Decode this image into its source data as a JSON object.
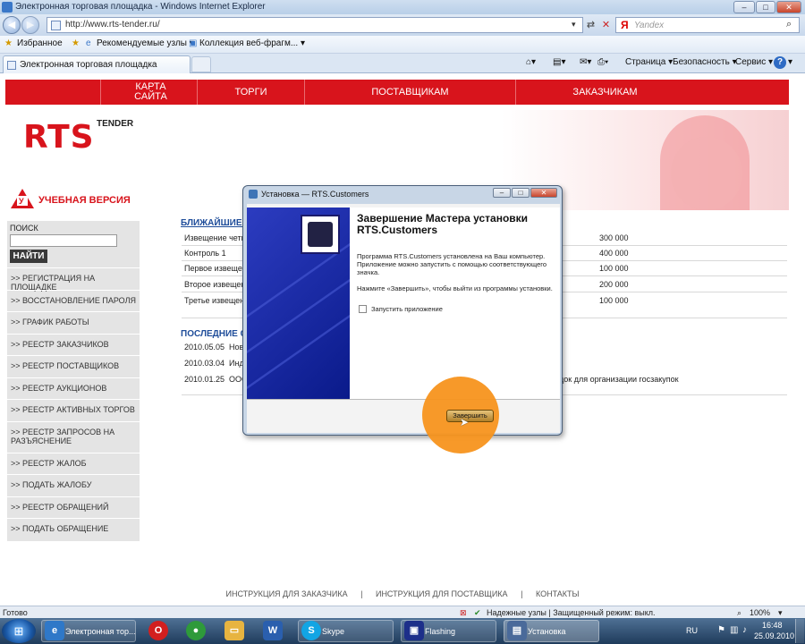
{
  "window": {
    "title": "Электронная торговая площадка - Windows Internet Explorer"
  },
  "address_bar": {
    "url": "http://www.rts-tender.ru/",
    "search_placeholder": "Yandex",
    "search_logo": "Я"
  },
  "favorites_bar": {
    "favorites_label": "Избранное",
    "items": [
      "Рекомендуемые узлы ▾",
      "Коллекция веб-фрагм... ▾"
    ]
  },
  "tabs": {
    "active_label": "Электронная торговая площадка"
  },
  "command_bar": {
    "page": "Страница ▾",
    "safety": "Безопасность ▾",
    "tools": "Сервис ▾"
  },
  "site_nav": {
    "items": [
      "КАРТА САЙТА",
      "ТОРГИ",
      "ПОСТАВЩИКАМ",
      "ЗАКАЗЧИКАМ"
    ]
  },
  "logo": {
    "main": "RTS",
    "sub": "TENDER"
  },
  "edu": {
    "label": "УЧЕБНАЯ ВЕРСИЯ",
    "sign": "У"
  },
  "sidebar": {
    "search_label": "ПОИСК",
    "search_value": "",
    "go": "НАЙТИ",
    "items": [
      ">> РЕГИСТРАЦИЯ НА ПЛОЩАДКЕ",
      ">> ВОССТАНОВЛЕНИЕ ПАРОЛЯ",
      ">> ГРАФИК РАБОТЫ",
      ">> РЕЕСТР ЗАКАЗЧИКОВ",
      ">> РЕЕСТР ПОСТАВЩИКОВ",
      ">> РЕЕСТР АУКЦИОНОВ",
      ">> РЕЕСТР АКТИВНЫХ ТОРГОВ",
      ">> РЕЕСТР ЗАПРОСОВ НА РАЗЪЯСНЕНИЕ",
      ">> РЕЕСТР ЖАЛОБ",
      ">> ПОДАТЬ ЖАЛОБУ",
      ">> РЕЕСТР ОБРАЩЕНИЙ",
      ">> ПОДАТЬ ОБРАЩЕНИЕ"
    ]
  },
  "auctions": {
    "title": "БЛИЖАЙШИЕ А",
    "rows": [
      {
        "name": "Извещение четы",
        "amount": "300 000"
      },
      {
        "name": "Контроль 1",
        "amount": "400 000"
      },
      {
        "name": "Первое извещен",
        "amount": "100 000"
      },
      {
        "name": "Второе извещен",
        "amount": "200 000"
      },
      {
        "name": "Третье извещен",
        "amount": "100 000"
      }
    ]
  },
  "news": {
    "title": "ПОСЛЕДНИЕ СО",
    "rows": [
      {
        "date": "2010.05.05",
        "text": "Нов"
      },
      {
        "date": "2010.03.04",
        "text": "Инд"
      },
      {
        "date": "2010.01.25",
        "text": "ООО",
        "tail": "адок для организации госзакупок"
      }
    ]
  },
  "footer": {
    "links": [
      "ИНСТРУКЦИЯ ДЛЯ ЗАКАЗЧИКА",
      "|",
      "ИНСТРУКЦИЯ ДЛЯ ПОСТАВЩИКА",
      "|",
      "КОНТАКТЫ"
    ]
  },
  "status_bar": {
    "left": "Готово",
    "zone": "Надежные узлы | Защищенный режим: выкл.",
    "zoom": "100%"
  },
  "taskbar": {
    "items": [
      "Электронная тор...",
      "Skype",
      "Flashing",
      "Установка"
    ],
    "lang": "RU",
    "time": "16:48",
    "date": "25.09.2010"
  },
  "dialog": {
    "title": "Установка — RTS.Customers",
    "heading": "Завершение Мастера установки RTS.Customers",
    "para1": "Программа RTS.Customers установлена на Ваш компьютер. Приложение можно запустить с помощью соответствующего значка.",
    "para2": "Нажмите «Завершить», чтобы выйти из программы установки.",
    "checkbox_label": "Запустить приложение",
    "checkbox_checked": false,
    "finish_button": "Завершить"
  },
  "colors": {
    "brand_red": "#d8141c",
    "highlight_orange": "#f7941d",
    "wizard_blue": "#0a1a8a"
  }
}
